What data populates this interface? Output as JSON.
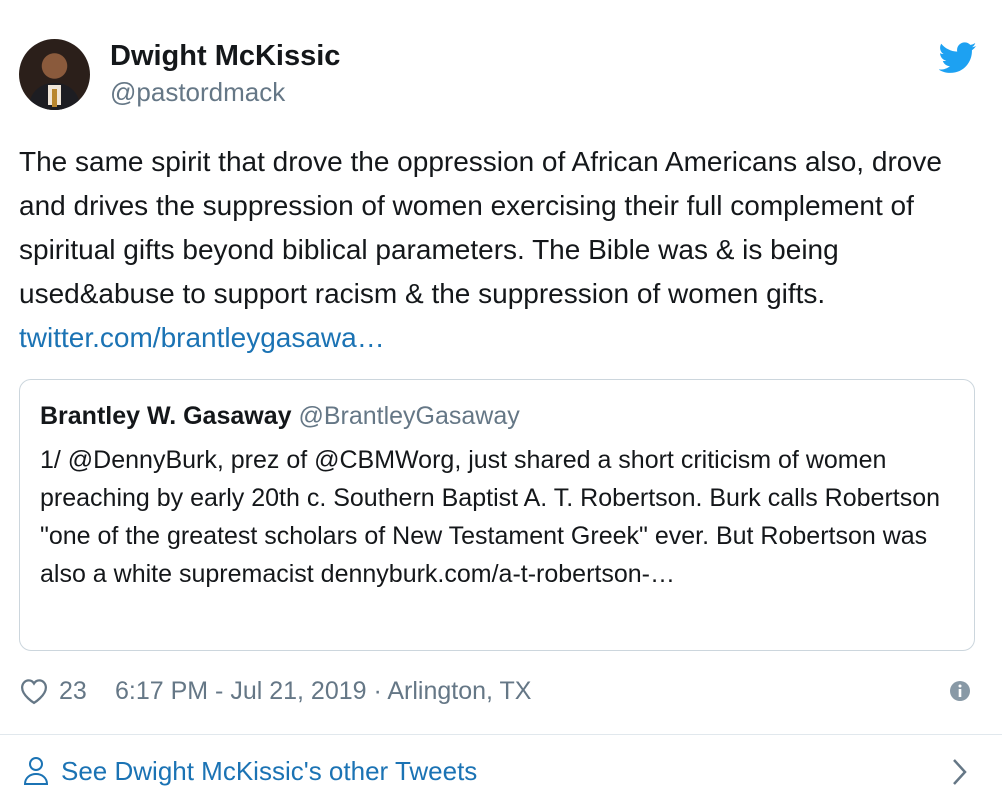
{
  "author": {
    "name": "Dwight McKissic",
    "handle": "@pastordmack",
    "avatar_icon": "user-avatar",
    "platform_icon": "twitter-bird-icon"
  },
  "tweet": {
    "text": "The same spirit that drove the oppression of African Americans also, drove and drives the suppression of women exercising their full complement of spiritual gifts beyond biblical parameters. The Bible was & is being used&abuse to support racism &  the suppression of women gifts.",
    "link_text": "twitter.com/brantleygasawa…"
  },
  "quoted_tweet": {
    "name": "Brantley W. Gasaway",
    "handle": "@BrantleyGasaway",
    "text": "1/ @DennyBurk, prez of @CBMWorg, just shared a short criticism of women preaching by early 20th c. Southern Baptist A. T. Robertson. Burk calls Robertson \"one of the greatest scholars of New Testament Greek\" ever. But Robertson was also a white supremacist dennyburk.com/a-t-robertson-…"
  },
  "meta": {
    "likes": "23",
    "timestamp": "6:17 PM - Jul 21, 2019 · Arlington, TX"
  },
  "footer": {
    "link_label": "See Dwight McKissic's other Tweets"
  },
  "colors": {
    "twitter_blue": "#1da1f2",
    "link_blue": "#1b73b4",
    "muted_gray": "#657786",
    "border_gray": "#ccd6dd"
  }
}
